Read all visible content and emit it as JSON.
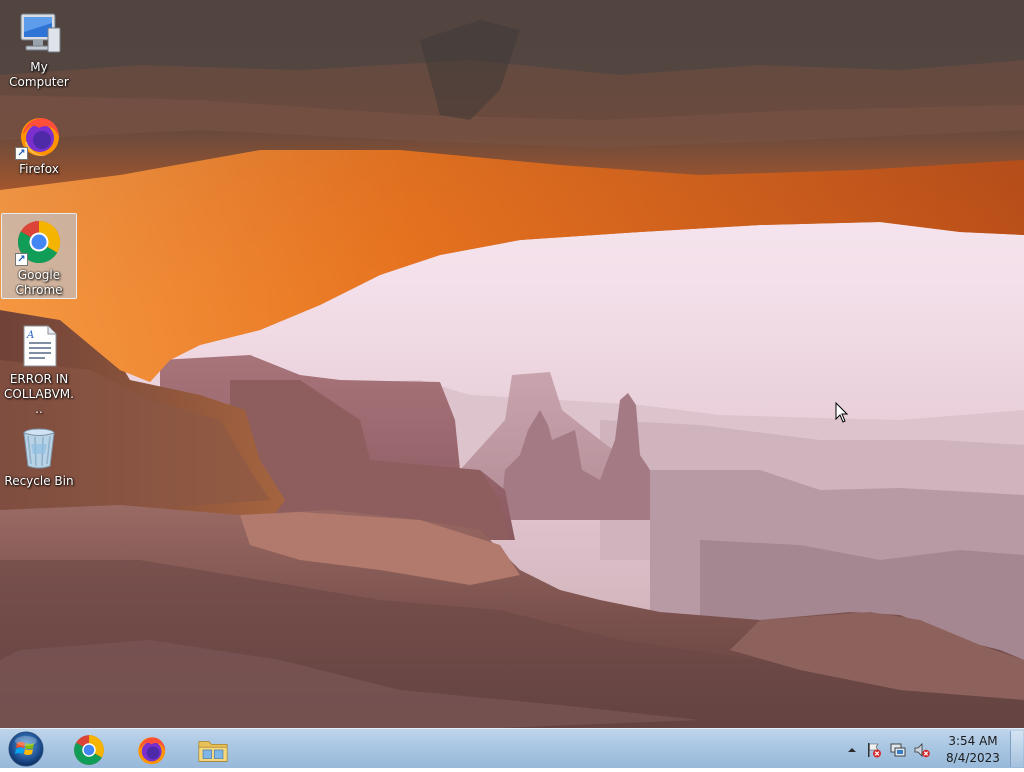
{
  "desktop": {
    "icons": [
      {
        "label": "My Computer",
        "icon": "computer-icon"
      },
      {
        "label": "Firefox",
        "icon": "firefox-icon"
      },
      {
        "label": "Google Chrome",
        "icon": "chrome-icon",
        "selected": true
      },
      {
        "label": "ERROR IN COLLABVM...",
        "icon": "document-icon"
      },
      {
        "label": "Recycle Bin",
        "icon": "recycle-bin-icon"
      }
    ]
  },
  "taskbar": {
    "pinned": [
      "chrome-icon",
      "firefox-icon",
      "file-explorer-icon"
    ],
    "tray_icons": [
      "show-hidden-icons-chevron",
      "action-center-flag-icon",
      "network-icon",
      "volume-muted-icon"
    ],
    "clock": {
      "time": "3:54 AM",
      "date": "8/4/2023"
    }
  },
  "colors": {
    "taskbar_top": "#bfd6ec",
    "taskbar_bottom": "#98b9da",
    "selection": "#b4cdeb",
    "sky": "#fbeff6",
    "arch_orange": "#e06a1a",
    "rock_dark": "#5a3a33"
  }
}
